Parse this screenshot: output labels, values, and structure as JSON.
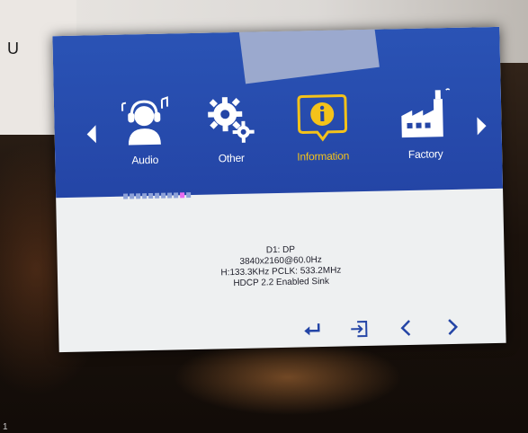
{
  "background": {
    "side_letter": "U",
    "corner_mark": "1"
  },
  "osd": {
    "colors": {
      "header": "#2445a6",
      "selected": "#f4c21a",
      "panel": "#eef0f1",
      "active_dot": "#e96cf0"
    },
    "menu": [
      {
        "label": "Audio",
        "icon": "headset-icon",
        "selected": false
      },
      {
        "label": "Other",
        "icon": "gears-icon",
        "selected": false
      },
      {
        "label": "Information",
        "icon": "info-icon",
        "selected": true
      },
      {
        "label": "Factory",
        "icon": "factory-icon",
        "selected": false
      }
    ],
    "page_dots": {
      "count": 11,
      "active_index": 9
    },
    "info": {
      "line1": "D1: DP",
      "line2": "3840x2160@60.0Hz",
      "line3": "H:133.3KHz   PCLK: 533.2MHz",
      "line4": "HDCP 2.2 Enabled Sink"
    },
    "nav_icons": [
      "enter-icon",
      "exit-icon",
      "left-arrow-icon",
      "right-arrow-icon"
    ]
  }
}
